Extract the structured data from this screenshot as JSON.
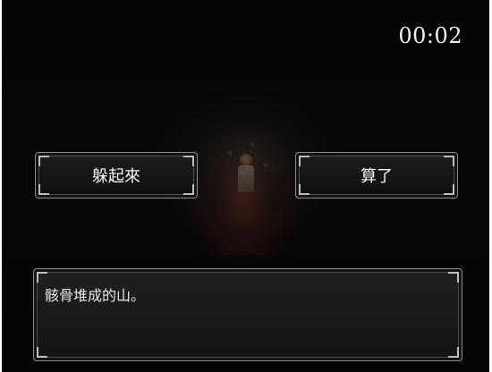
{
  "hud": {
    "timer": "00:02"
  },
  "choices": [
    {
      "label": "躲起來"
    },
    {
      "label": "算了"
    }
  ],
  "message": {
    "text": "骸骨堆成的山。"
  },
  "colors": {
    "background": "#050505",
    "frame_border": "#8a8a8a",
    "text": "#f4f4f4"
  }
}
